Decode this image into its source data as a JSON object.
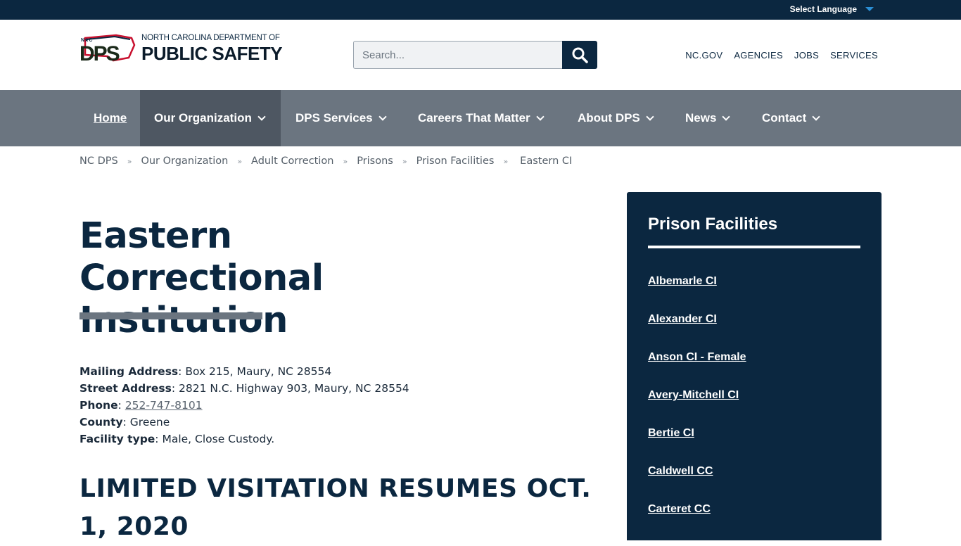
{
  "utility": {
    "language_label": "Select Language"
  },
  "header": {
    "logo": {
      "top_line": "NORTH CAROLINA DEPARTMENT OF",
      "bottom_line": "PUBLIC SAFETY",
      "mark_text": "DPS",
      "mark_small": "N★C"
    },
    "search": {
      "placeholder": "Search..."
    },
    "links": [
      "NC.GOV",
      "AGENCIES",
      "JOBS",
      "SERVICES"
    ]
  },
  "nav": {
    "items": [
      {
        "label": "Home"
      },
      {
        "label": "Our Organization"
      },
      {
        "label": "DPS Services"
      },
      {
        "label": "Careers That Matter"
      },
      {
        "label": "About DPS"
      },
      {
        "label": "News"
      },
      {
        "label": "Contact"
      }
    ]
  },
  "breadcrumb": {
    "items": [
      "NC DPS",
      "Our Organization",
      "Adult Correction",
      "Prisons",
      "Prison Facilities"
    ],
    "current": "Eastern CI",
    "separator": "»"
  },
  "main": {
    "title": "Eastern Correctional Institution",
    "info": [
      {
        "key": "Mailing Address",
        "value": " Box 215, Maury, NC 28554"
      },
      {
        "key": "Street Address",
        "value": " 2821 N.C. Highway 903, Maury, NC 28554"
      },
      {
        "key": "Phone",
        "value": "252-747-8101"
      },
      {
        "key": "County",
        "value": " Greene"
      },
      {
        "key": "Facility type",
        "value": " Male, Close Custody."
      }
    ],
    "info_colon": ":",
    "section_heading": "LIMITED VISITATION RESUMES OCT. 1, 2020"
  },
  "sidebar": {
    "title": "Prison Facilities",
    "links": [
      "Albemarle CI",
      "Alexander CI",
      "Anson CI - Female",
      "Avery-Mitchell CI",
      "Bertie CI",
      "Caldwell CC",
      "Carteret CC"
    ]
  },
  "colors": {
    "navy": "#0b2740",
    "nav_gray": "#6b7580",
    "nav_active": "#4e5762",
    "lang_caret": "#2b8fd6",
    "logo_red": "#c8102e"
  }
}
